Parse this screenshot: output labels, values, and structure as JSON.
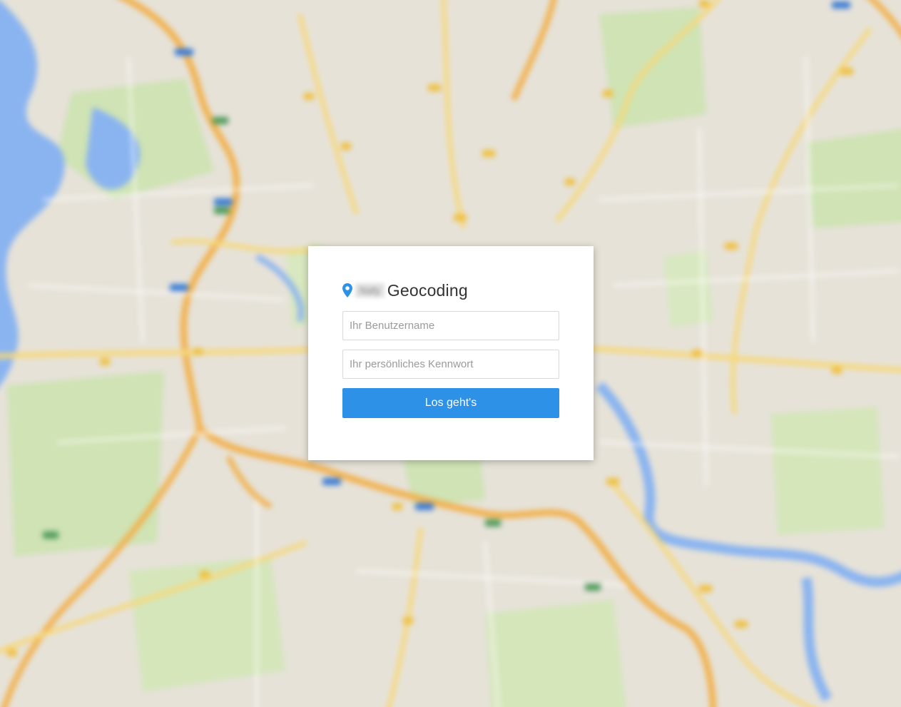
{
  "login": {
    "brand_blurred": "Nafy",
    "title": "Geocoding",
    "username": {
      "placeholder": "Ihr Benutzername",
      "value": ""
    },
    "password": {
      "placeholder": "Ihr persönliches Kennwort",
      "value": ""
    },
    "submit_label": "Los geht's"
  },
  "colors": {
    "accent": "#2e91e8",
    "pin": "#2e91e8",
    "map_land": "#e8e4da",
    "map_park": "#cfe3b4",
    "map_water": "#8ab4f0",
    "map_highway": "#f2b04a",
    "map_road": "#f7d878"
  },
  "icons": {
    "pin": "map-pin-icon"
  }
}
